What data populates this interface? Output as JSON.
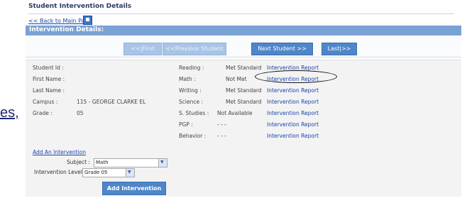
{
  "fragment": {
    "text": "es,"
  },
  "page": {
    "title": "Student Intervention Details",
    "back_link": "<< Back to Main Page",
    "section_header": "Intervention Details:"
  },
  "nav": {
    "first": "<<|First",
    "previous": "<<Previous Student",
    "next": "Next Student >>",
    "last": "Last|>>"
  },
  "student": {
    "labels": {
      "student_id": "Student Id :",
      "first_name": "First Name :",
      "last_name": "Last Name :",
      "campus": "Campus :",
      "grade": "Grade :"
    },
    "values": {
      "campus": "115 - GEORGE CLARKE EL",
      "grade": "05"
    }
  },
  "subjects": [
    {
      "label": "Reading :",
      "status": "Met Standard",
      "link": "Intervention Report"
    },
    {
      "label": "Math :",
      "status": "Not Met",
      "link": "Intervention Report"
    },
    {
      "label": "Writing :",
      "status": "Met Standard",
      "link": "Intervention Report"
    },
    {
      "label": "Science :",
      "status": "Met Standard",
      "link": "Intervention Report"
    },
    {
      "label": "S. Studies :",
      "status": "Not Available",
      "link": "Intervention Report"
    },
    {
      "label": "PGP :",
      "status": "- - -",
      "link": "Intervention Report"
    },
    {
      "label": "Behavior :",
      "status": "- - -",
      "link": "Intervention Report"
    }
  ],
  "add_intervention": {
    "link": "Add An Intervention",
    "subject_label": "Subject :",
    "subject_value": "Math",
    "level_label": "Intervention Level:",
    "level_value": "Grade 05",
    "button": "Add Intervention"
  },
  "colors": {
    "header_bar": "#7aa2d4",
    "button": "#4f86c9",
    "link": "#1b44a8",
    "info_bg": "#f3f3f3"
  }
}
